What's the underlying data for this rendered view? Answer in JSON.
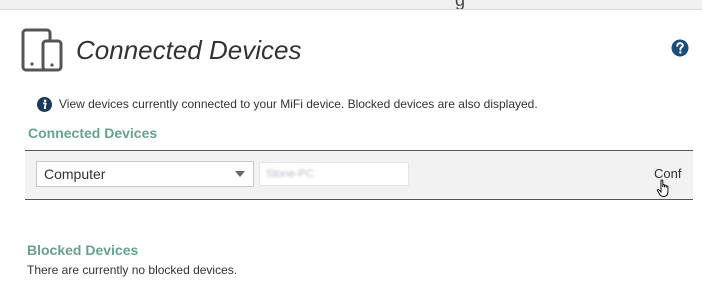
{
  "header": {
    "top_strip_glyph": "g",
    "title": "Connected Devices"
  },
  "info": {
    "text": "View devices currently connected to your MiFi device. Blocked devices are also displayed."
  },
  "connected": {
    "heading": "Connected Devices",
    "rows": [
      {
        "device_type": "Computer",
        "device_name": "Stone-PC",
        "action_label": "Conf"
      }
    ]
  },
  "blocked": {
    "heading": "Blocked Devices",
    "empty_text": "There are currently no blocked devices."
  },
  "colors": {
    "accent": "#6aa08f",
    "help_icon": "#1a4e7a",
    "row_background": "#f2f2f2"
  },
  "icons": {
    "device": "mobile-device-icon",
    "help": "help-icon",
    "info": "info-icon",
    "dropdown": "chevron-down-icon",
    "cursor": "hand-cursor-icon"
  }
}
